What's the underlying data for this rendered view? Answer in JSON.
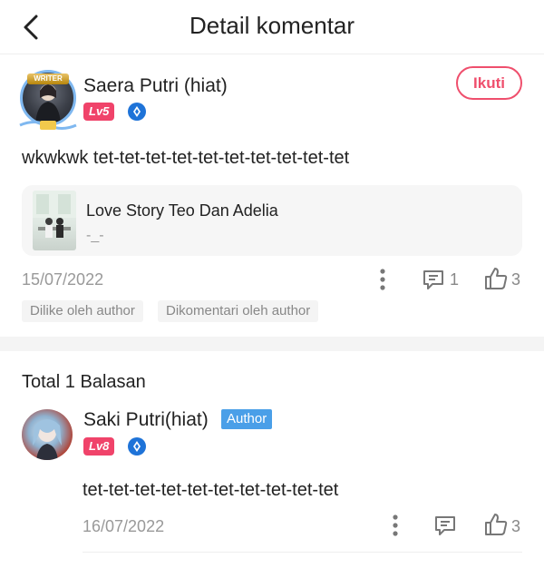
{
  "header": {
    "title": "Detail komentar",
    "back_icon": "chevron-left-icon"
  },
  "comment": {
    "username": "Saera Putri (hiat)",
    "avatar_badge": "WRITER",
    "level": "Lv5",
    "follow_label": "Ikuti",
    "text": "wkwkwk tet-tet-tet-tet-tet-tet-tet-tet-tet-tet",
    "book": {
      "title": "Love Story Teo Dan Adelia",
      "subtitle": "-_-"
    },
    "date": "15/07/2022",
    "reply_count": "1",
    "like_count": "3",
    "tags": [
      "Dilike oleh author",
      "Dikomentari oleh author"
    ]
  },
  "replies": {
    "title": "Total 1 Balasan",
    "items": [
      {
        "username": "Saki Putri(hiat)",
        "author_badge": "Author",
        "level": "Lv8",
        "text": "tet-tet-tet-tet-tet-tet-tet-tet-tet-tet",
        "date": "16/07/2022",
        "like_count": "3"
      }
    ]
  },
  "colors": {
    "accent_pink": "#ef4f6d",
    "level_badge": "#f0436a",
    "author_blue": "#4a9fe8",
    "vip_blue": "#1e73d8"
  }
}
